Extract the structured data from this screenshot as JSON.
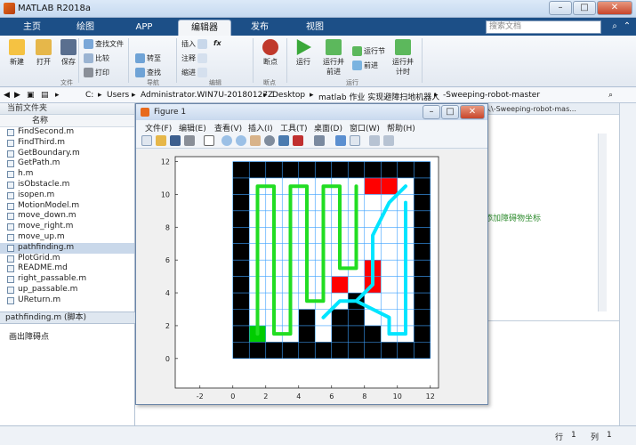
{
  "app": {
    "title": "MATLAB R2018a"
  },
  "window_buttons": {
    "minimize": "–",
    "maximize": "□",
    "close": "✕"
  },
  "tabs": [
    "主页",
    "绘图",
    "APP",
    "编辑器",
    "发布",
    "视图"
  ],
  "search": {
    "placeholder": "搜索文档"
  },
  "ribbon": {
    "file": {
      "new": "新建",
      "open": "打开",
      "save": "保存",
      "find_files": "查找文件",
      "compare": "比较",
      "print": "打印",
      "group": "文件"
    },
    "nav": {
      "goto": "转至",
      "find": "查找",
      "group": "导航"
    },
    "edit": {
      "insert": "插入",
      "fx": "fx",
      "comment": "注释",
      "indent": "缩进",
      "group": "编辑"
    },
    "breakpoints": {
      "label": "断点",
      "group": "断点"
    },
    "run": {
      "run": "运行",
      "run_advance": "运行并\n前进",
      "run_section": "运行节",
      "advance": "前进",
      "run_time": "运行并\n计时",
      "group": "运行"
    }
  },
  "address": {
    "parts": [
      "C:",
      "Users",
      "Administrator.WIN7U-20180127Z",
      "Desktop",
      "matlab 作业 实现避障扫地机器人",
      "-Sweeping-robot-master"
    ]
  },
  "left_panel": {
    "header": "当前文件夹",
    "column": "名称",
    "files": [
      "FindSecond.m",
      "FindThird.m",
      "GetBoundary.m",
      "GetPath.m",
      "h.m",
      "isObstacle.m",
      "isopen.m",
      "MotionModel.m",
      "move_down.m",
      "move_right.m",
      "move_up.m",
      "pathfinding.m",
      "PlotGrid.m",
      "README.md",
      "right_passable.m",
      "up_passable.m",
      "UReturn.m"
    ],
    "selected": "pathfinding.m",
    "detail": "pathfinding.m  (脚本)",
    "detail_text": "画出障碍点"
  },
  "editor": {
    "header": "人\\-Sweeping-robot-mas...",
    "green_text": "添加障碍物坐标"
  },
  "status": {
    "row_label": "行",
    "row": "1",
    "col_label": "列",
    "col": "1"
  },
  "figure": {
    "title": "Figure 1",
    "menu": [
      "文件(F)",
      "编辑(E)",
      "查看(V)",
      "插入(I)",
      "工具(T)",
      "桌面(D)",
      "窗口(W)",
      "帮助(H)"
    ]
  },
  "chart_data": {
    "type": "heatmap",
    "title": "",
    "xlabel": "",
    "ylabel": "",
    "xlim": [
      -3.5,
      12.5
    ],
    "ylim": [
      -1.8,
      12.3
    ],
    "xticks": [
      -2,
      0,
      2,
      4,
      6,
      8,
      10,
      12
    ],
    "yticks": [
      0,
      2,
      4,
      6,
      8,
      10,
      12
    ],
    "grid": true,
    "grid_cells": [
      0,
      11
    ],
    "colors": {
      "obstacle": "#000000",
      "free": "#ffffff",
      "start": "#00cc00",
      "target": "#ff0000",
      "grid": "#3aa0ff",
      "path1": "#22dd22",
      "path2": "#00e5ff"
    },
    "obstacles": [
      [
        0,
        0
      ],
      [
        0,
        1
      ],
      [
        0,
        2
      ],
      [
        0,
        3
      ],
      [
        0,
        4
      ],
      [
        0,
        5
      ],
      [
        0,
        6
      ],
      [
        0,
        7
      ],
      [
        0,
        8
      ],
      [
        0,
        9
      ],
      [
        0,
        10
      ],
      [
        0,
        11
      ],
      [
        11,
        0
      ],
      [
        11,
        1
      ],
      [
        11,
        2
      ],
      [
        11,
        3
      ],
      [
        11,
        4
      ],
      [
        11,
        5
      ],
      [
        11,
        6
      ],
      [
        11,
        7
      ],
      [
        11,
        8
      ],
      [
        11,
        9
      ],
      [
        11,
        10
      ],
      [
        11,
        11
      ],
      [
        1,
        0
      ],
      [
        2,
        0
      ],
      [
        3,
        0
      ],
      [
        4,
        0
      ],
      [
        5,
        0
      ],
      [
        6,
        0
      ],
      [
        7,
        0
      ],
      [
        8,
        0
      ],
      [
        9,
        0
      ],
      [
        10,
        0
      ],
      [
        1,
        11
      ],
      [
        2,
        11
      ],
      [
        3,
        11
      ],
      [
        4,
        11
      ],
      [
        5,
        11
      ],
      [
        6,
        11
      ],
      [
        7,
        11
      ],
      [
        8,
        11
      ],
      [
        9,
        11
      ],
      [
        10,
        11
      ],
      [
        4,
        1
      ],
      [
        4,
        2
      ],
      [
        6,
        1
      ],
      [
        6,
        2
      ],
      [
        7,
        1
      ],
      [
        7,
        2
      ],
      [
        7,
        3
      ],
      [
        8,
        4
      ],
      [
        8,
        1
      ]
    ],
    "targets": [
      [
        8,
        10
      ],
      [
        9,
        10
      ],
      [
        6,
        4
      ],
      [
        8,
        4
      ],
      [
        8,
        5
      ]
    ],
    "start": [
      [
        1,
        1
      ]
    ],
    "path1": [
      [
        1.5,
        1.5
      ],
      [
        1.5,
        10.5
      ],
      [
        2.5,
        10.5
      ],
      [
        2.5,
        1.5
      ],
      [
        3.5,
        1.5
      ],
      [
        3.5,
        10.5
      ],
      [
        4.5,
        10.5
      ],
      [
        4.5,
        3.5
      ],
      [
        5.5,
        3.5
      ],
      [
        5.5,
        10.5
      ],
      [
        6.5,
        10.5
      ],
      [
        6.5,
        5.5
      ],
      [
        7.5,
        5.5
      ],
      [
        7.5,
        10.5
      ]
    ],
    "path2": [
      [
        10.5,
        10.5
      ],
      [
        9.5,
        9.5
      ],
      [
        8.5,
        7.5
      ],
      [
        8.5,
        4.5
      ],
      [
        7.5,
        3.5
      ],
      [
        6.5,
        3.5
      ],
      [
        5.5,
        2.5
      ],
      [
        6.5,
        3.5
      ],
      [
        7.5,
        3.5
      ],
      [
        9.5,
        2.5
      ],
      [
        9.5,
        1.5
      ],
      [
        10.5,
        1.5
      ],
      [
        10.5,
        9.5
      ]
    ]
  }
}
